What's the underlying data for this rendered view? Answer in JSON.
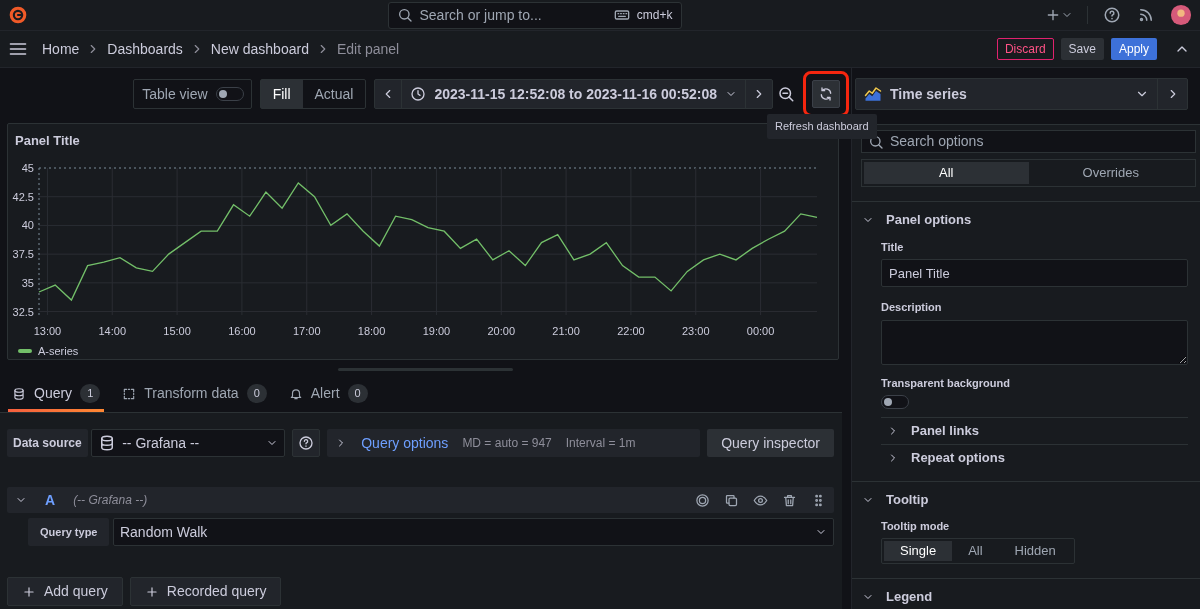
{
  "topbar": {
    "search_placeholder": "Search or jump to...",
    "shortcut": "cmd+k"
  },
  "breadcrumbs": [
    {
      "label": "Home",
      "current": false
    },
    {
      "label": "Dashboards",
      "current": false
    },
    {
      "label": "New dashboard",
      "current": false
    },
    {
      "label": "Edit panel",
      "current": true
    }
  ],
  "actions": [
    {
      "label": "Discard",
      "kind": "danger"
    },
    {
      "label": "Save",
      "kind": "secondary"
    },
    {
      "label": "Apply",
      "kind": "primary"
    }
  ],
  "toolbar": {
    "table_view": {
      "label": "Table view",
      "on": false
    },
    "size_modes": [
      {
        "label": "Fill",
        "selected": true
      },
      {
        "label": "Actual",
        "selected": false
      }
    ],
    "time_range": "2023-11-15 12:52:08 to 2023-11-16 00:52:08",
    "refresh": {
      "highlighted": true,
      "tooltip": "Refresh dashboard"
    }
  },
  "panel": {
    "title": "Panel Title",
    "chart_data": {
      "type": "line",
      "x": [
        12.87,
        13.12,
        13.37,
        13.62,
        13.87,
        14.12,
        14.37,
        14.62,
        14.87,
        15.12,
        15.37,
        15.62,
        15.87,
        16.12,
        16.37,
        16.62,
        16.87,
        17.12,
        17.37,
        17.62,
        17.87,
        18.12,
        18.37,
        18.62,
        18.87,
        19.12,
        19.37,
        19.62,
        19.87,
        20.12,
        20.37,
        20.62,
        20.87,
        21.12,
        21.37,
        21.62,
        21.87,
        22.12,
        22.37,
        22.62,
        22.87,
        23.12,
        23.37,
        23.62,
        23.87,
        24.12,
        24.37,
        24.62,
        24.87
      ],
      "series": [
        {
          "name": "A-series",
          "color": "#73bf69",
          "values": [
            34.2,
            34.8,
            33.5,
            36.5,
            36.8,
            37.2,
            36.3,
            36.0,
            37.5,
            38.5,
            39.5,
            39.5,
            41.8,
            40.8,
            42.9,
            41.5,
            43.7,
            42.5,
            40.0,
            41.0,
            39.5,
            38.2,
            40.8,
            40.5,
            39.8,
            39.5,
            38.0,
            38.8,
            37.0,
            37.8,
            36.5,
            38.5,
            39.2,
            37.0,
            37.5,
            38.5,
            36.5,
            35.5,
            35.5,
            34.3,
            36.0,
            37.0,
            37.5,
            37.0,
            38.0,
            38.8,
            39.5,
            41.0,
            40.7
          ]
        }
      ],
      "grid": true,
      "xlim": [
        12.87,
        24.87
      ],
      "ylim": [
        32.2,
        45
      ],
      "xticks": [
        {
          "value": 13,
          "label": "13:00"
        },
        {
          "value": 14,
          "label": "14:00"
        },
        {
          "value": 15,
          "label": "15:00"
        },
        {
          "value": 16,
          "label": "16:00"
        },
        {
          "value": 17,
          "label": "17:00"
        },
        {
          "value": 18,
          "label": "18:00"
        },
        {
          "value": 19,
          "label": "19:00"
        },
        {
          "value": 20,
          "label": "20:00"
        },
        {
          "value": 21,
          "label": "21:00"
        },
        {
          "value": 22,
          "label": "22:00"
        },
        {
          "value": 23,
          "label": "23:00"
        },
        {
          "value": 24,
          "label": "00:00"
        }
      ],
      "yticks": [
        32.5,
        35,
        37.5,
        40,
        42.5,
        45
      ]
    }
  },
  "query_tabs": [
    {
      "label": "Query",
      "count": "1",
      "selected": true
    },
    {
      "label": "Transform data",
      "count": "0",
      "selected": false
    },
    {
      "label": "Alert",
      "count": "0",
      "selected": false
    }
  ],
  "query_row": {
    "data_source_label": "Data source",
    "data_source": "-- Grafana --",
    "query_options": "Query options",
    "max_data_points": "MD = auto = 947",
    "interval": "Interval = 1m",
    "inspector": "Query inspector"
  },
  "queries": [
    {
      "ref": "A",
      "source": "(-- Grafana --)",
      "expanded": true,
      "field_label": "Query type",
      "field_value": "Random Walk"
    }
  ],
  "query_buttons": [
    "Add query",
    "Recorded query"
  ],
  "options_pane": {
    "visualization": "Time series",
    "search_placeholder": "Search options",
    "tabs": [
      {
        "label": "All",
        "selected": true
      },
      {
        "label": "Overrides",
        "selected": false
      }
    ],
    "sections": [
      {
        "title": "Panel options",
        "expanded": true,
        "items": [
          {
            "kind": "input",
            "label": "Title",
            "value": "Panel Title"
          },
          {
            "kind": "textarea",
            "label": "Description"
          },
          {
            "kind": "switch",
            "label": "Transparent background",
            "on": false
          },
          {
            "kind": "subsection",
            "label": "Panel links",
            "expanded": false
          },
          {
            "kind": "subsection",
            "label": "Repeat options",
            "expanded": false
          }
        ]
      },
      {
        "title": "Tooltip",
        "expanded": true,
        "items": [
          {
            "kind": "radio",
            "label": "Tooltip mode",
            "options": [
              {
                "label": "Single",
                "selected": true
              },
              {
                "label": "All",
                "selected": false
              },
              {
                "label": "Hidden",
                "selected": false
              }
            ]
          }
        ]
      },
      {
        "title": "Legend",
        "expanded": true
      }
    ]
  }
}
